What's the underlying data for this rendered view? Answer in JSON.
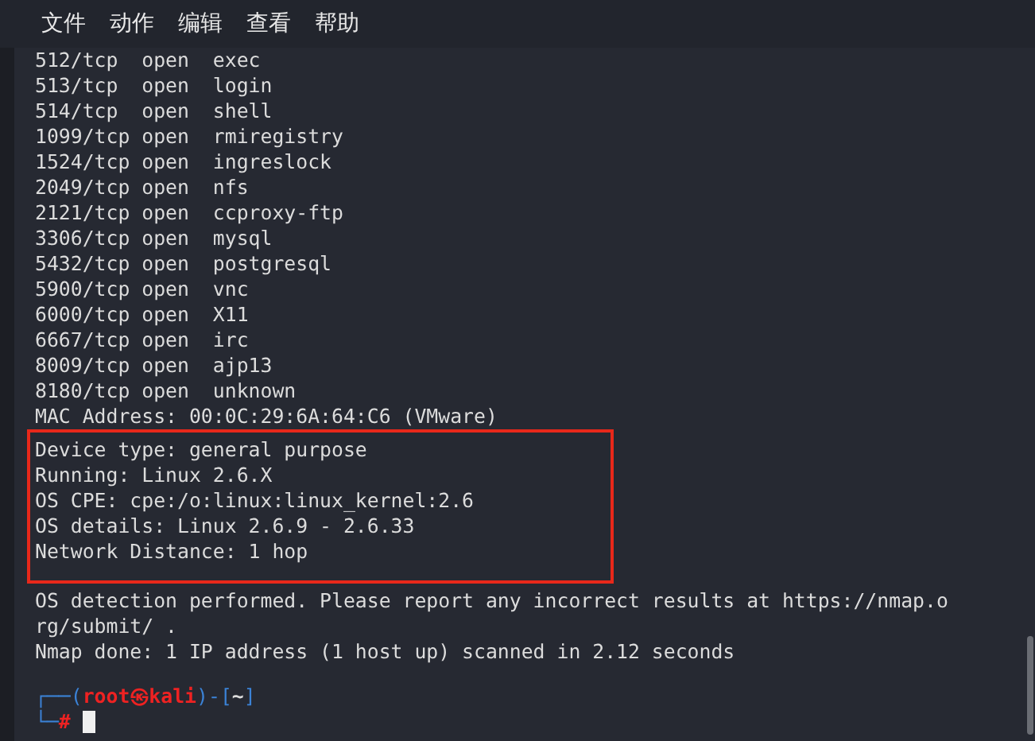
{
  "menu": [
    "文件",
    "动作",
    "编辑",
    "查看",
    "帮助"
  ],
  "terminal": {
    "lines": [
      "512/tcp  open  exec",
      "513/tcp  open  login",
      "514/tcp  open  shell",
      "1099/tcp open  rmiregistry",
      "1524/tcp open  ingreslock",
      "2049/tcp open  nfs",
      "2121/tcp open  ccproxy-ftp",
      "3306/tcp open  mysql",
      "5432/tcp open  postgresql",
      "5900/tcp open  vnc",
      "6000/tcp open  X11",
      "6667/tcp open  irc",
      "8009/tcp open  ajp13",
      "8180/tcp open  unknown",
      "MAC Address: 00:0C:29:6A:64:C6 (VMware)"
    ],
    "highlighted_lines": [
      "Device type: general purpose",
      "Running: Linux 2.6.X",
      "OS CPE: cpe:/o:linux:linux_kernel:2.6",
      "OS details: Linux 2.6.9 - 2.6.33",
      "Network Distance: 1 hop"
    ],
    "after_lines": [
      "OS detection performed. Please report any incorrect results at https://nmap.o",
      "rg/submit/ .",
      "Nmap done: 1 IP address (1 host up) scanned in 2.12 seconds"
    ],
    "prompt_line_1": [
      {
        "kind": "frame",
        "text": "┌──("
      },
      {
        "kind": "user",
        "text": "root㉿kali"
      },
      {
        "kind": "frame",
        "text": ")-["
      },
      {
        "kind": "path",
        "text": "~"
      },
      {
        "kind": "frame",
        "text": "]"
      }
    ],
    "prompt_line_2": [
      {
        "kind": "frame",
        "text": "└─"
      },
      {
        "kind": "user",
        "text": "#"
      }
    ]
  }
}
